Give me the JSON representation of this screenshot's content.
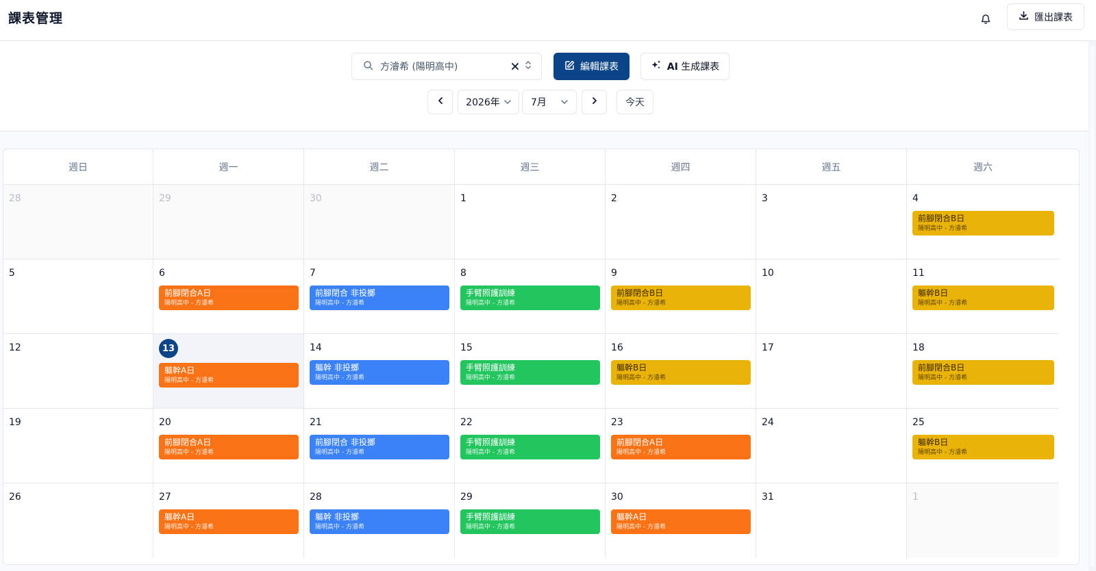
{
  "header": {
    "title": "課表管理",
    "export_label": "匯出課表"
  },
  "toolbar": {
    "student_value": "方濬希 (陽明高中)",
    "edit_label": "編輯課表",
    "ai_prefix": "AI",
    "ai_label": "生成課表",
    "year_value": "2026年",
    "month_value": "7月",
    "today_label": "今天"
  },
  "colors": {
    "primary": "#0b4587",
    "orange": "#f97316",
    "blue": "#3b82f6",
    "green": "#22c55e",
    "yellow": "#eab308"
  },
  "calendar": {
    "weekdays": [
      "週日",
      "週一",
      "週二",
      "週三",
      "週四",
      "週五",
      "週六"
    ],
    "today": "13",
    "weeks": [
      [
        {
          "day": "28",
          "outside": true,
          "events": []
        },
        {
          "day": "29",
          "outside": true,
          "events": []
        },
        {
          "day": "30",
          "outside": true,
          "events": []
        },
        {
          "day": "1",
          "events": []
        },
        {
          "day": "2",
          "events": []
        },
        {
          "day": "3",
          "events": []
        },
        {
          "day": "4",
          "events": [
            {
              "title": "前腳閉合B日",
              "subtitle": "陽明高中 - 方濬希",
              "color": "yellow"
            }
          ]
        }
      ],
      [
        {
          "day": "5",
          "events": []
        },
        {
          "day": "6",
          "events": [
            {
              "title": "前腳閉合A日",
              "subtitle": "陽明高中 - 方濬希",
              "color": "orange"
            }
          ]
        },
        {
          "day": "7",
          "events": [
            {
              "title": "前腳閉合 非投擲",
              "subtitle": "陽明高中 - 方濬希",
              "color": "blue"
            }
          ]
        },
        {
          "day": "8",
          "events": [
            {
              "title": "手臂照護訓練",
              "subtitle": "陽明高中 - 方濬希",
              "color": "green"
            }
          ]
        },
        {
          "day": "9",
          "events": [
            {
              "title": "前腳閉合B日",
              "subtitle": "陽明高中 - 方濬希",
              "color": "yellow"
            }
          ]
        },
        {
          "day": "10",
          "events": []
        },
        {
          "day": "11",
          "events": [
            {
              "title": "軀幹B日",
              "subtitle": "陽明高中 - 方濬希",
              "color": "yellow"
            }
          ]
        }
      ],
      [
        {
          "day": "12",
          "events": []
        },
        {
          "day": "13",
          "today": true,
          "events": [
            {
              "title": "軀幹A日",
              "subtitle": "陽明高中 - 方濬希",
              "color": "orange"
            }
          ]
        },
        {
          "day": "14",
          "events": [
            {
              "title": "軀幹 非投擲",
              "subtitle": "陽明高中 - 方濬希",
              "color": "blue"
            }
          ]
        },
        {
          "day": "15",
          "events": [
            {
              "title": "手臂照護訓練",
              "subtitle": "陽明高中 - 方濬希",
              "color": "green"
            }
          ]
        },
        {
          "day": "16",
          "events": [
            {
              "title": "軀幹B日",
              "subtitle": "陽明高中 - 方濬希",
              "color": "yellow"
            }
          ]
        },
        {
          "day": "17",
          "events": []
        },
        {
          "day": "18",
          "events": [
            {
              "title": "前腳閉合B日",
              "subtitle": "陽明高中 - 方濬希",
              "color": "yellow"
            }
          ]
        }
      ],
      [
        {
          "day": "19",
          "events": []
        },
        {
          "day": "20",
          "events": [
            {
              "title": "前腳閉合A日",
              "subtitle": "陽明高中 - 方濬希",
              "color": "orange"
            }
          ]
        },
        {
          "day": "21",
          "events": [
            {
              "title": "前腳閉合 非投擲",
              "subtitle": "陽明高中 - 方濬希",
              "color": "blue"
            }
          ]
        },
        {
          "day": "22",
          "events": [
            {
              "title": "手臂照護訓練",
              "subtitle": "陽明高中 - 方濬希",
              "color": "green"
            }
          ]
        },
        {
          "day": "23",
          "events": [
            {
              "title": "前腳閉合A日",
              "subtitle": "陽明高中 - 方濬希",
              "color": "orange"
            }
          ]
        },
        {
          "day": "24",
          "events": []
        },
        {
          "day": "25",
          "events": [
            {
              "title": "軀幹B日",
              "subtitle": "陽明高中 - 方濬希",
              "color": "yellow"
            }
          ]
        }
      ],
      [
        {
          "day": "26",
          "events": []
        },
        {
          "day": "27",
          "events": [
            {
              "title": "軀幹A日",
              "subtitle": "陽明高中 - 方濬希",
              "color": "orange"
            }
          ]
        },
        {
          "day": "28",
          "events": [
            {
              "title": "軀幹 非投擲",
              "subtitle": "陽明高中 - 方濬希",
              "color": "blue"
            }
          ]
        },
        {
          "day": "29",
          "events": [
            {
              "title": "手臂照護訓練",
              "subtitle": "陽明高中 - 方濬希",
              "color": "green"
            }
          ]
        },
        {
          "day": "30",
          "events": [
            {
              "title": "軀幹A日",
              "subtitle": "陽明高中 - 方濬希",
              "color": "orange"
            }
          ]
        },
        {
          "day": "31",
          "events": []
        },
        {
          "day": "1",
          "outside": true,
          "events": []
        }
      ]
    ]
  }
}
